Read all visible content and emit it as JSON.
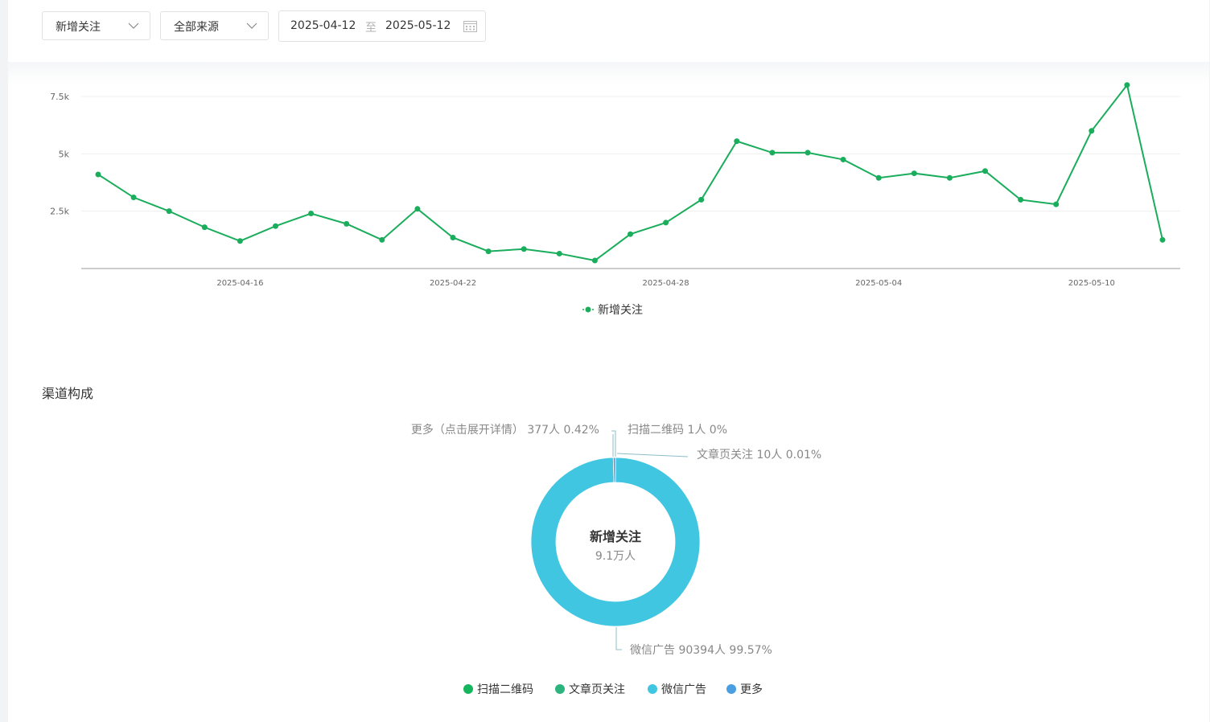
{
  "toolbar": {
    "metric_select": "新增关注",
    "source_select": "全部来源",
    "date_start": "2025-04-12",
    "date_separator": "至",
    "date_end": "2025-05-12",
    "icons": [
      "chevron-down-icon",
      "calendar-icon"
    ]
  },
  "colors": {
    "line_green": "#1aad5c",
    "qr_green": "#15b55d",
    "article_green": "#2db37d",
    "ad_cyan": "#41c6e2",
    "more_blue": "#4a9fe3"
  },
  "chart_data": [
    {
      "type": "line",
      "x": [
        "2025-04-12",
        "2025-04-13",
        "2025-04-14",
        "2025-04-15",
        "2025-04-16",
        "2025-04-17",
        "2025-04-18",
        "2025-04-19",
        "2025-04-20",
        "2025-04-21",
        "2025-04-22",
        "2025-04-23",
        "2025-04-24",
        "2025-04-25",
        "2025-04-26",
        "2025-04-27",
        "2025-04-28",
        "2025-04-29",
        "2025-04-30",
        "2025-05-01",
        "2025-05-02",
        "2025-05-03",
        "2025-05-04",
        "2025-05-05",
        "2025-05-06",
        "2025-05-07",
        "2025-05-08",
        "2025-05-09",
        "2025-05-10",
        "2025-05-11",
        "2025-05-12"
      ],
      "series": [
        {
          "name": "新增关注",
          "values": [
            4100,
            3100,
            2500,
            1800,
            1200,
            1850,
            2400,
            1950,
            1250,
            2600,
            1350,
            750,
            850,
            650,
            350,
            1500,
            2000,
            3000,
            5550,
            5050,
            5050,
            4750,
            3950,
            4150,
            3950,
            4250,
            3000,
            2800,
            6000,
            8000,
            1250
          ]
        }
      ],
      "xticks": [
        "2025-04-16",
        "2025-04-22",
        "2025-04-28",
        "2025-05-04",
        "2025-05-10"
      ],
      "yticks": [
        "2.5k",
        "5k",
        "7.5k"
      ],
      "ylim": [
        0,
        8200
      ],
      "legend": "bottom-center",
      "grid": true
    },
    {
      "type": "pie",
      "center_title": "新增关注",
      "center_value": "9.1万人",
      "slices": [
        {
          "name": "扫描二维码",
          "value": 1,
          "percent": "0%",
          "label": "扫描二维码 1人 0%"
        },
        {
          "name": "文章页关注",
          "value": 10,
          "percent": "0.01%",
          "label": "文章页关注 10人 0.01%"
        },
        {
          "name": "微信广告",
          "value": 90394,
          "percent": "99.57%",
          "label": "微信广告 90394人 99.57%"
        },
        {
          "name": "更多",
          "value": 377,
          "percent": "0.42%",
          "label": "更多（点击展开详情） 377人 0.42%"
        }
      ],
      "legend": "bottom-center"
    }
  ],
  "section": {
    "channel_title": "渠道构成"
  }
}
